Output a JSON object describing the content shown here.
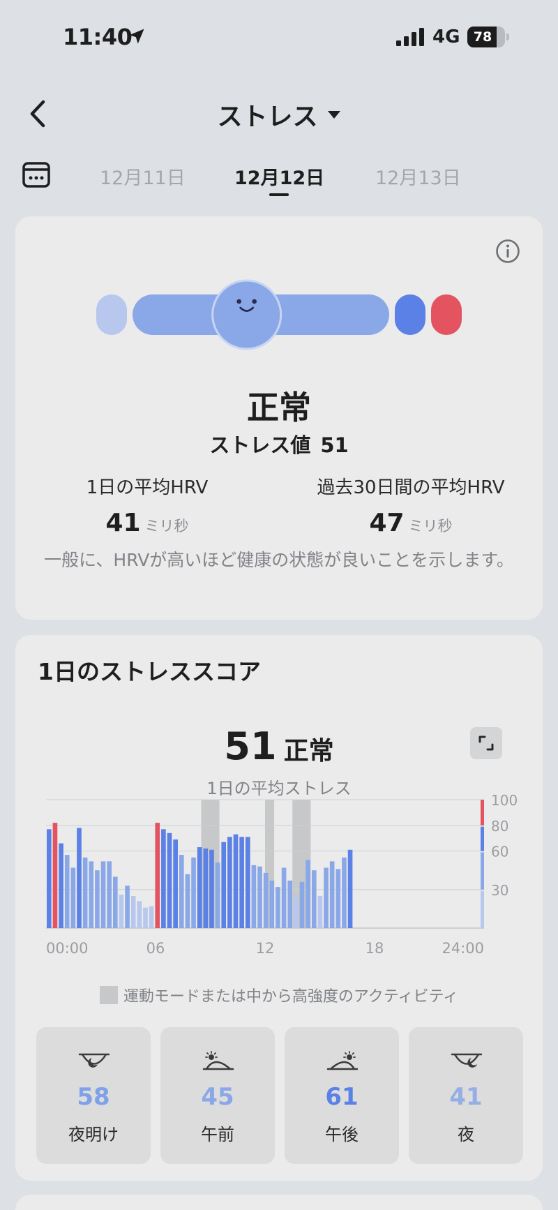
{
  "status_bar": {
    "time": "11:40",
    "network": "4G",
    "battery": "78",
    "battery_level": 0.78
  },
  "header": {
    "title": "ストレス"
  },
  "date_nav": {
    "dates": [
      "12月11日",
      "12月12日",
      "12月13日"
    ],
    "selected_index": 1
  },
  "summary": {
    "level": "正常",
    "stress_label": "ストレス値",
    "stress_value": "51",
    "stress_scale": {
      "min": 0,
      "max": 100,
      "value": 51
    },
    "hrv_daily_label": "1日の平均HRV",
    "hrv_daily_value": "41",
    "hrv_30day_label": "過去30日間の平均HRV",
    "hrv_30day_value": "47",
    "hrv_unit": "ミリ秒",
    "note": "一般に、HRVが高いほど健康の状態が良いことを示します。"
  },
  "daily_score": {
    "title": "1日のストレススコア",
    "average_value": "51",
    "average_level": "正常",
    "average_label": "1日の平均ストレス",
    "legend_text": "運動モードまたは中から高強度のアクティビティ",
    "periods": [
      {
        "value": "58",
        "label": "夜明け",
        "icon": "dawn-icon",
        "color": "#7fa1ea"
      },
      {
        "value": "45",
        "label": "午前",
        "icon": "morning-icon",
        "color": "#8aa8e8"
      },
      {
        "value": "61",
        "label": "午後",
        "icon": "afternoon-icon",
        "color": "#5b80e6"
      },
      {
        "value": "41",
        "label": "夜",
        "icon": "night-icon",
        "color": "#95afe6"
      }
    ]
  },
  "chart_data": {
    "type": "bar",
    "x_tick_labels": [
      "00:00",
      "06",
      "12",
      "18",
      "24:00"
    ],
    "y_tick_labels": [
      "100",
      "80",
      "60",
      "30"
    ],
    "ylim": [
      0,
      100
    ],
    "x_hours": [
      0,
      24
    ],
    "bar_width_hours": 0.33,
    "values": [
      77,
      82,
      66,
      57,
      47,
      78,
      55,
      52,
      45,
      52,
      52,
      40,
      26,
      33,
      25,
      21,
      16,
      17,
      82,
      77,
      74,
      69,
      57,
      42,
      55,
      63,
      62,
      61,
      51,
      67,
      71,
      73,
      71,
      71,
      49,
      48,
      43,
      37,
      32,
      47,
      37,
      24,
      36,
      53,
      45,
      25,
      47,
      52,
      46,
      55,
      61
    ],
    "activity_periods_hours": [
      [
        8.5,
        9.5
      ],
      [
        12.0,
        12.5
      ],
      [
        13.5,
        14.5
      ]
    ],
    "current_value": 77,
    "bands": [
      {
        "min": 0,
        "max": 29,
        "color": "#b7c7ee"
      },
      {
        "min": 30,
        "max": 59,
        "color": "#8aa8e8"
      },
      {
        "min": 60,
        "max": 79,
        "color": "#5b80e6"
      },
      {
        "min": 80,
        "max": 100,
        "color": "#e35460"
      }
    ],
    "activity_color": "#c7c8ca"
  }
}
